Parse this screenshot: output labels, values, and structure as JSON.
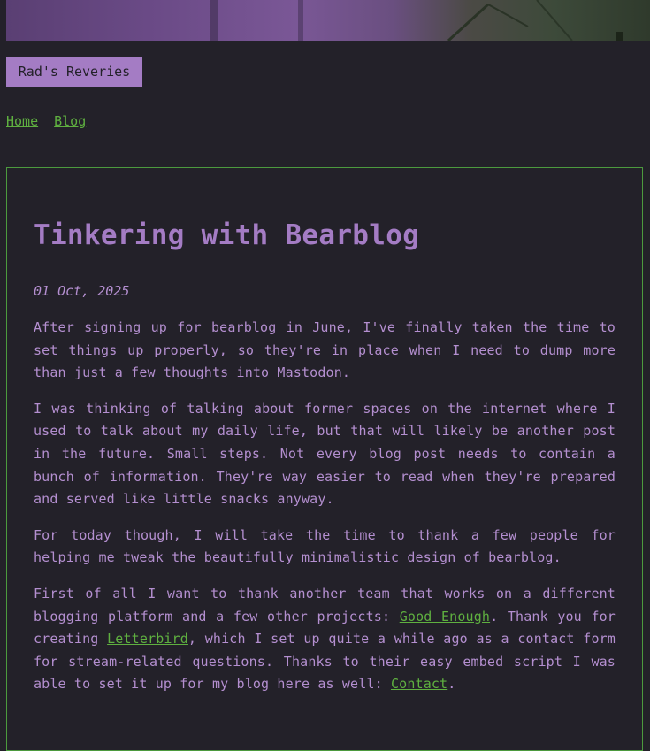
{
  "site": {
    "title": "Rad's Reveries"
  },
  "nav": {
    "items": [
      {
        "label": "Home"
      },
      {
        "label": "Blog"
      }
    ]
  },
  "post": {
    "title": "Tinkering with Bearblog",
    "date": "01 Oct, 2025",
    "p1": "After signing up for bearblog in June, I've finally taken the time to set things up properly, so they're in place when I need to dump more than just a few thoughts into Mastodon.",
    "p2": "I was thinking of talking about former spaces on the internet where I used to talk about my daily life, but that will likely be another post in the future. Small steps. Not every blog post needs to contain a bunch of information. They're way easier to read when they're prepared and served like little snacks anyway.",
    "p3": "For today though, I will take the time to thank a few people for helping me tweak the beautifully minimalistic design of bearblog.",
    "p4": {
      "t1": "First of all I want to thank another team that works on a different blogging platform and a few other projects: ",
      "link1": "Good Enough",
      "t2": ". Thank you for creating ",
      "link2": "Letterbird",
      "t3": ", which I set up quite a while ago as a contact form for stream-related questions. Thanks to their easy embed script I was able to set it up for my blog here as well: ",
      "link3": "Contact",
      "t4": "."
    }
  },
  "colors": {
    "background": "#232129",
    "accent": "#a47cc4",
    "text": "#b48fd0",
    "link": "#5fb040",
    "border": "#4c9a3e"
  }
}
